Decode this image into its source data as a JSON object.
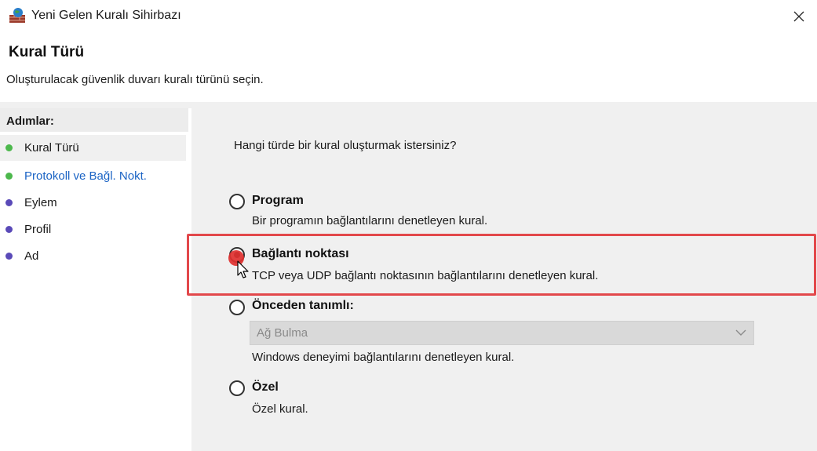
{
  "window": {
    "title": "Yeni Gelen Kuralı Sihirbazı",
    "close_symbol": "✕"
  },
  "header": {
    "title": "Kural Türü",
    "description": "Oluşturulacak güvenlik duvarı kuralı türünü seçin."
  },
  "steps": {
    "title": "Adımlar:",
    "items": [
      {
        "label": "Kural Türü",
        "state": "current",
        "dot_color": "#4cb84c"
      },
      {
        "label": "Protokoll ve Bağl. Nokt.",
        "state": "link",
        "dot_color": "#4cb84c"
      },
      {
        "label": "Eylem",
        "state": "pending",
        "dot_color": "#5a4ab8"
      },
      {
        "label": "Profil",
        "state": "pending",
        "dot_color": "#5a4ab8"
      },
      {
        "label": "Ad",
        "state": "pending",
        "dot_color": "#5a4ab8"
      }
    ]
  },
  "main": {
    "question": "Hangi türde bir kural oluşturmak istersiniz?",
    "options": [
      {
        "label": "Program",
        "description": "Bir programın bağlantılarını denetleyen kural.",
        "selected": false
      },
      {
        "label": "Bağlantı noktası",
        "description": "TCP veya UDP bağlantı noktasının bağlantılarını denetleyen kural.",
        "selected": true
      },
      {
        "label": "Önceden tanımlı:",
        "description": "Windows deneyimi bağlantılarını denetleyen kural.",
        "selected": false,
        "dropdown_value": "Ağ Bulma"
      },
      {
        "label": "Özel",
        "description": "Özel kural.",
        "selected": false
      }
    ]
  },
  "colors": {
    "highlight": "#e2484b",
    "link": "#1a63c4",
    "panel_bg": "#f0f0f0"
  }
}
